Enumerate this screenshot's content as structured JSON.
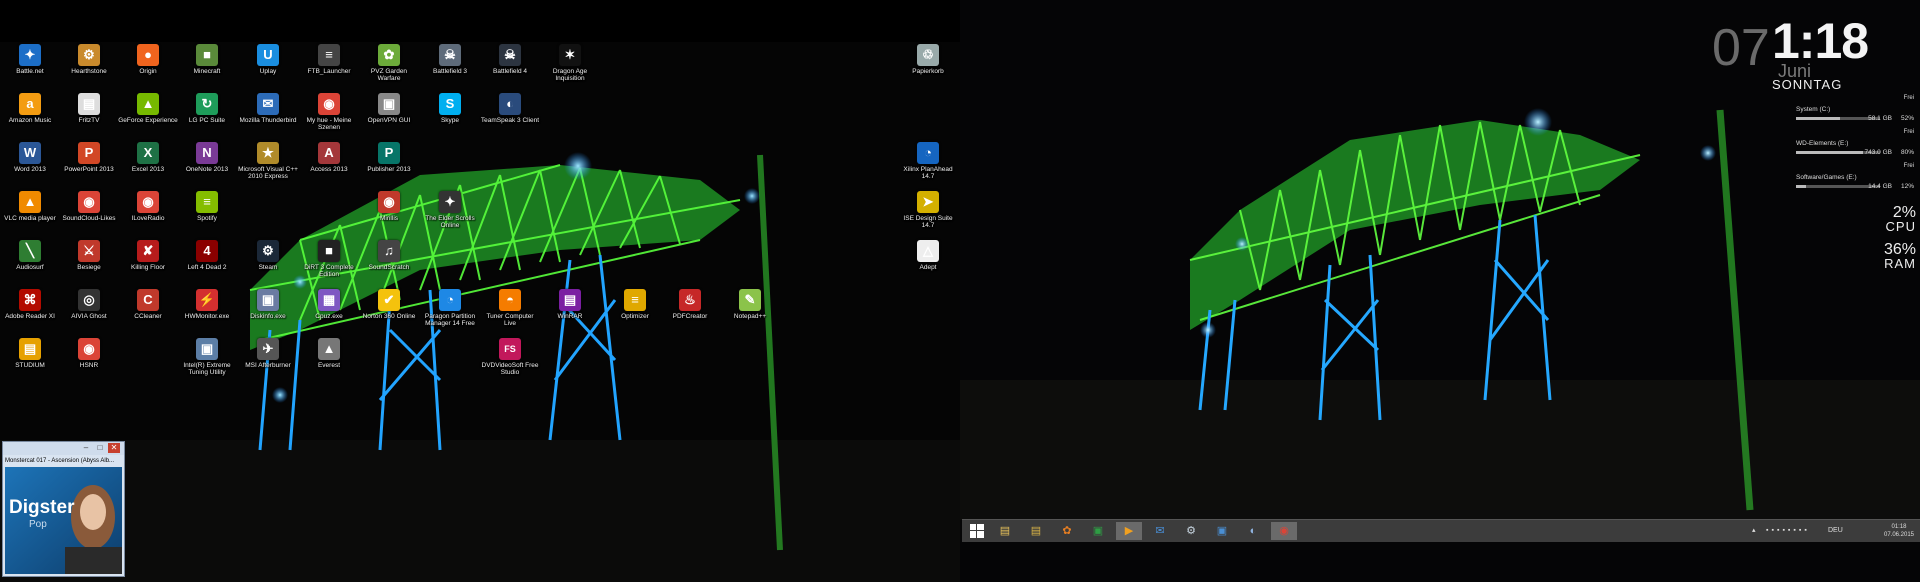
{
  "desktop_left": {
    "icons": [
      {
        "label": "Battle.net",
        "icon": "battlenet-icon",
        "color": "#1c6ec7",
        "glyph": "✦"
      },
      {
        "label": "Hearthstone",
        "icon": "hearthstone-icon",
        "color": "#c98a2c",
        "glyph": "⚙"
      },
      {
        "label": "Origin",
        "icon": "origin-icon",
        "color": "#f0641e",
        "glyph": "●"
      },
      {
        "label": "Minecraft",
        "icon": "minecraft-icon",
        "color": "#5a8a3a",
        "glyph": "■"
      },
      {
        "label": "Uplay",
        "icon": "uplay-icon",
        "color": "#1a8ee0",
        "glyph": "U"
      },
      {
        "label": "FTB_Launcher",
        "icon": "ftb-icon",
        "color": "#444",
        "glyph": "≡"
      },
      {
        "label": "PVZ Garden Warfare",
        "icon": "pvz-icon",
        "color": "#6cab3a",
        "glyph": "✿"
      },
      {
        "label": "Battlefield 3",
        "icon": "battlefield3-icon",
        "color": "#5e6b7a",
        "glyph": "☠"
      },
      {
        "label": "Battlefield 4",
        "icon": "battlefield4-icon",
        "color": "#2c3440",
        "glyph": "☠"
      },
      {
        "label": "Dragon Age Inquisition",
        "icon": "dragon-age-icon",
        "color": "#111",
        "glyph": "✶"
      },
      {
        "label": "Amazon Music",
        "icon": "amazon-music-icon",
        "color": "#f39c12",
        "glyph": "a"
      },
      {
        "label": "FritzTV",
        "icon": "fritztv-icon",
        "color": "#ddd",
        "glyph": "▤"
      },
      {
        "label": "GeForce Experience",
        "icon": "geforce-icon",
        "color": "#76b900",
        "glyph": "▲"
      },
      {
        "label": "LG PC Suite",
        "icon": "lg-icon",
        "color": "#1e9c5a",
        "glyph": "↻"
      },
      {
        "label": "Mozilla Thunderbird",
        "icon": "thunderbird-icon",
        "color": "#2c6bb8",
        "glyph": "✉"
      },
      {
        "label": "My hue - Meine Szenen",
        "icon": "chrome-app-icon",
        "color": "#db4437",
        "glyph": "◉"
      },
      {
        "label": "OpenVPN GUI",
        "icon": "openvpn-icon",
        "color": "#888",
        "glyph": "▣"
      },
      {
        "label": "Skype",
        "icon": "skype-icon",
        "color": "#00aff0",
        "glyph": "S"
      },
      {
        "label": "TeamSpeak 3 Client",
        "icon": "teamspeak-icon",
        "color": "#2a4b7c",
        "glyph": "◐"
      },
      {
        "label": "Word 2013",
        "icon": "word-icon",
        "color": "#2b5797",
        "glyph": "W"
      },
      {
        "label": "PowerPoint 2013",
        "icon": "powerpoint-icon",
        "color": "#d24726",
        "glyph": "P"
      },
      {
        "label": "Excel 2013",
        "icon": "excel-icon",
        "color": "#1e7145",
        "glyph": "X"
      },
      {
        "label": "OneNote 2013",
        "icon": "onenote-icon",
        "color": "#7a3a96",
        "glyph": "N"
      },
      {
        "label": "Microsoft Visual C++ 2010 Express",
        "icon": "visual-cpp-icon",
        "color": "#b08b2a",
        "glyph": "★"
      },
      {
        "label": "Access 2013",
        "icon": "access-icon",
        "color": "#a4373a",
        "glyph": "A"
      },
      {
        "label": "Publisher 2013",
        "icon": "publisher-icon",
        "color": "#077568",
        "glyph": "P"
      },
      {
        "label": "VLC media player",
        "icon": "vlc-icon",
        "color": "#f08a00",
        "glyph": "▲"
      },
      {
        "label": "SoundCloud-Likes",
        "icon": "soundcloud-chrome-icon",
        "color": "#db4437",
        "glyph": "◉"
      },
      {
        "label": "ILoveRadio",
        "icon": "iloveradio-chrome-icon",
        "color": "#db4437",
        "glyph": "◉"
      },
      {
        "label": "Spotify",
        "icon": "spotify-icon",
        "color": "#84bd00",
        "glyph": "≡"
      },
      {
        "label": "Mirillis",
        "icon": "mirillis-icon",
        "color": "#c0392b",
        "glyph": "◉"
      },
      {
        "label": "The Elder Scrolls Online",
        "icon": "elder-scrolls-icon",
        "color": "#333",
        "glyph": "✦"
      },
      {
        "label": "Audiosurf",
        "icon": "audiosurf-icon",
        "color": "#2e7d32",
        "glyph": "╲"
      },
      {
        "label": "Besiege",
        "icon": "besiege-icon",
        "color": "#c0392b",
        "glyph": "⚔"
      },
      {
        "label": "Killing Floor",
        "icon": "killing-floor-icon",
        "color": "#b71c1c",
        "glyph": "✘"
      },
      {
        "label": "Left 4 Dead 2",
        "icon": "left4dead-icon",
        "color": "#8b0000",
        "glyph": "4"
      },
      {
        "label": "Steam",
        "icon": "steam-icon",
        "color": "#1b2838",
        "glyph": "⚙"
      },
      {
        "label": "DiRT 3 Complete Edition",
        "icon": "dirt3-icon",
        "color": "#222",
        "glyph": "■"
      },
      {
        "label": "SoundScratch",
        "icon": "soundscratch-icon",
        "color": "#444",
        "glyph": "♫"
      },
      {
        "label": "Adobe Reader XI",
        "icon": "adobe-reader-icon",
        "color": "#b30b00",
        "glyph": "⌘"
      },
      {
        "label": "AIVIA Ghost",
        "icon": "aivia-icon",
        "color": "#333",
        "glyph": "◎"
      },
      {
        "label": "CCleaner",
        "icon": "ccleaner-icon",
        "color": "#c0392b",
        "glyph": "C"
      },
      {
        "label": "HWMonitor.exe",
        "icon": "hwmonitor-icon",
        "color": "#d32f2f",
        "glyph": "⚡"
      },
      {
        "label": "Diskinfo.exe",
        "icon": "diskinfo-icon",
        "color": "#6a7ba2",
        "glyph": "▣"
      },
      {
        "label": "Cpuz.exe",
        "icon": "cpuz-icon",
        "color": "#7e57c2",
        "glyph": "▦"
      },
      {
        "label": "Norton 360 Online",
        "icon": "norton-icon",
        "color": "#f4c20d",
        "glyph": "✔"
      },
      {
        "label": "Paragon Partition Manager 14 Free",
        "icon": "paragon-icon",
        "color": "#1e88e5",
        "glyph": "◔"
      },
      {
        "label": "Tuner Computer Live",
        "icon": "tuner-icon",
        "color": "#f57c00",
        "glyph": "◓"
      },
      {
        "label": "WinRAR",
        "icon": "winrar-icon",
        "color": "#7b1fa2",
        "glyph": "▤"
      },
      {
        "label": "Optimizer",
        "icon": "optimizer-icon",
        "color": "#e0a800",
        "glyph": "≡"
      },
      {
        "label": "PDFCreator",
        "icon": "pdfcreator-icon",
        "color": "#c62828",
        "glyph": "♨"
      },
      {
        "label": "Notepad++",
        "icon": "notepadpp-icon",
        "color": "#8bc34a",
        "glyph": "✎"
      },
      {
        "label": "STUDIUM",
        "icon": "studium-icon",
        "color": "#e6a100",
        "glyph": "▤"
      },
      {
        "label": "HSNR",
        "icon": "hsnr-chrome-icon",
        "color": "#db4437",
        "glyph": "◉"
      },
      {
        "label": "Intel(R) Extreme Tuning Utility",
        "icon": "intel-xtu-icon",
        "color": "#5c7ea6",
        "glyph": "▣"
      },
      {
        "label": "MSI Afterburner",
        "icon": "afterburner-icon",
        "color": "#555",
        "glyph": "✈"
      },
      {
        "label": "Everest",
        "icon": "everest-icon",
        "color": "#777",
        "glyph": "▲"
      },
      {
        "label": "DVDVideoSoft Free Studio",
        "icon": "freestudio-icon",
        "color": "#c2185b",
        "glyph": "FS"
      },
      {
        "label": "Papierkorb",
        "icon": "recycle-bin-icon",
        "color": "#9aa",
        "glyph": "♲"
      },
      {
        "label": "Xilinx PlanAhead 14.7",
        "icon": "xilinx-planahead-icon",
        "color": "#1565c0",
        "glyph": "◔"
      },
      {
        "label": "ISE Design Suite 14.7",
        "icon": "ise-design-icon",
        "color": "#d4b000",
        "glyph": "➤"
      },
      {
        "label": "Adept",
        "icon": "adept-icon",
        "color": "#eee",
        "glyph": "△"
      }
    ]
  },
  "player": {
    "now_playing": "Monstercat 017 - Ascension (Abyss Alb...",
    "art_brand": "Digster",
    "art_sub": "Pop",
    "min_label": "–",
    "max_label": "□",
    "close_label": "✕"
  },
  "clock": {
    "day": "07",
    "time": "1:18",
    "month": "Juni",
    "weekday": "SONNTAG"
  },
  "drives": [
    {
      "name": "System (C:)",
      "free_label": "Frei",
      "size": "58.1 GB",
      "pct": "52%",
      "fill": 0.52
    },
    {
      "name": "WD-Elements (E:)",
      "free_label": "Frei",
      "size": "743.0 GB",
      "pct": "80%",
      "fill": 0.8
    },
    {
      "name": "Software/Games (E:)",
      "free_label": "Frei",
      "size": "14.4 GB",
      "pct": "12%",
      "fill": 0.12
    }
  ],
  "meters": {
    "cpu_value": "2%",
    "cpu_label": "CPU",
    "ram_value": "36%",
    "ram_label": "RAM"
  },
  "taskbar": {
    "start_icon": "windows-start-icon",
    "items": [
      {
        "name": "file-explorer-icon",
        "glyph": "▤",
        "color": "#e8c25a"
      },
      {
        "name": "folder-icon",
        "glyph": "▤",
        "color": "#d9b347"
      },
      {
        "name": "paint-icon",
        "glyph": "✿",
        "color": "#e67e22"
      },
      {
        "name": "store-icon",
        "glyph": "▣",
        "color": "#2e9e44"
      },
      {
        "name": "media-player-icon",
        "glyph": "▶",
        "color": "#f0a020"
      },
      {
        "name": "thunderbird-icon",
        "glyph": "✉",
        "color": "#4a90d9"
      },
      {
        "name": "steam-icon",
        "glyph": "⚙",
        "color": "#c7d5e0"
      },
      {
        "name": "xilinx-icon",
        "glyph": "▣",
        "color": "#4a8fd4"
      },
      {
        "name": "teamspeak-icon",
        "glyph": "◐",
        "color": "#8fb3e0"
      },
      {
        "name": "chrome-icon",
        "glyph": "◉",
        "color": "#db4437"
      }
    ],
    "tray": {
      "show_hidden": "▴",
      "language": "DEU",
      "time": "01:18",
      "date": "07.06.2015"
    }
  }
}
